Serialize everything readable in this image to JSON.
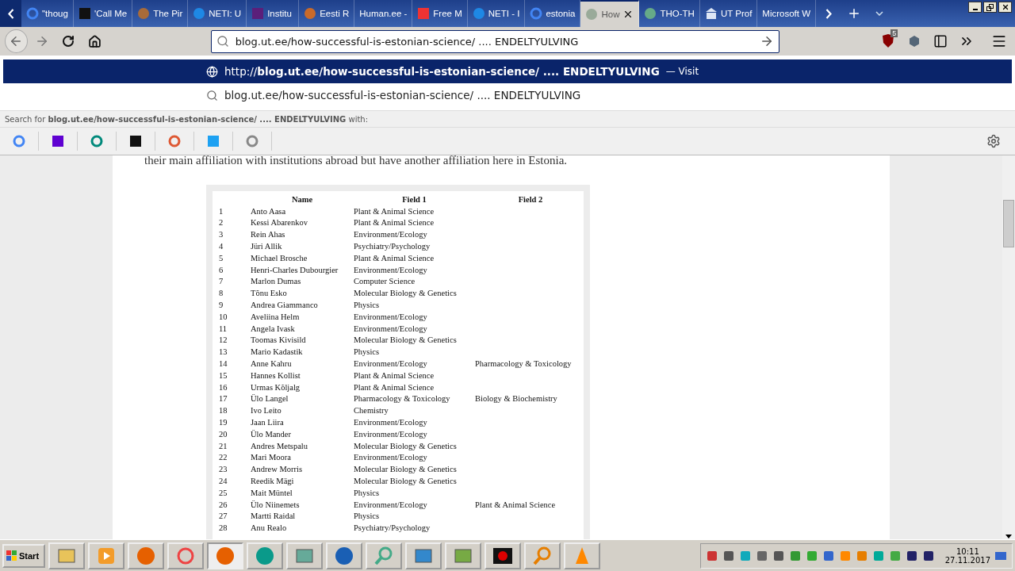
{
  "tabs": [
    {
      "label": "\"thoug",
      "selected": false
    },
    {
      "label": "'Call Me",
      "selected": false
    },
    {
      "label": "The Pir",
      "selected": false
    },
    {
      "label": "NETI: U",
      "selected": false
    },
    {
      "label": "Institu",
      "selected": false
    },
    {
      "label": "Eesti R",
      "selected": false
    },
    {
      "label": "Human.ee -",
      "selected": false
    },
    {
      "label": "Free M",
      "selected": false
    },
    {
      "label": "NETI - I",
      "selected": false
    },
    {
      "label": "estonia",
      "selected": false
    },
    {
      "label": "How",
      "selected": true
    },
    {
      "label": "THO-TH",
      "selected": false
    },
    {
      "label": "UT Prof",
      "selected": false
    },
    {
      "label": "Microsoft W",
      "selected": false
    }
  ],
  "address_bar": {
    "value": "blog.ut.ee/how-successful-is-estonian-science/ .... ENDELTYULVING"
  },
  "toolbar": {
    "ublock_badge": "5"
  },
  "dropdown": {
    "visit_row": {
      "url": "http://**blog.ut.ee/how-successful-is-estonian-science/ .... ENDELTYULVING**",
      "action": "— Visit",
      "selected": true
    },
    "search_row": {
      "text": "blog.ut.ee/how-successful-is-estonian-science/ .... ENDELTYULVING",
      "selected": false
    },
    "search_for": "Search for **blog.ut.ee/how-successful-is-estonian-science/ .... ENDELTYULVING** with:"
  },
  "page": {
    "paragraph": "their main affiliation with institutions abroad but have another affiliation here in Estonia.",
    "table": {
      "columns": [
        "Name",
        "Field  1",
        "Field 2"
      ],
      "rows": [
        {
          "num": "1",
          "name": "Anto Aasa",
          "field1": "Plant & Animal Science"
        },
        {
          "num": "2",
          "name": "Kessi Abarenkov",
          "field1": "Plant & Animal Science"
        },
        {
          "num": "3",
          "name": "Rein Ahas",
          "field1": "Environment/Ecology"
        },
        {
          "num": "4",
          "name": "Jüri Allik",
          "field1": "Psychiatry/Psychology"
        },
        {
          "num": "5",
          "name": "Michael Brosche",
          "field1": "Plant & Animal Science"
        },
        {
          "num": "6",
          "name": "Henri-Charles Dubourgier",
          "field1": "Environment/Ecology"
        },
        {
          "num": "7",
          "name": "Marlon Dumas",
          "field1": "Computer Science"
        },
        {
          "num": "8",
          "name": "Tõnu Esko",
          "field1": "Molecular Biology & Genetics"
        },
        {
          "num": "9",
          "name": "Andrea Giammanco",
          "field1": "Physics"
        },
        {
          "num": "10",
          "name": "Aveliina Helm",
          "field1": "Environment/Ecology"
        },
        {
          "num": "11",
          "name": "Angela Ivask",
          "field1": "Environment/Ecology"
        },
        {
          "num": "12",
          "name": "Toomas Kivisild",
          "field1": "Molecular Biology & Genetics"
        },
        {
          "num": "13",
          "name": "Mario Kadastik",
          "field1": "Physics"
        },
        {
          "num": "14",
          "name": "Anne Kahru",
          "field1": "Environment/Ecology",
          "field2": "Pharmacology & Toxicology"
        },
        {
          "num": "15",
          "name": "Hannes Kollist",
          "field1": "Plant & Animal Science"
        },
        {
          "num": "16",
          "name": "Urmas Kõljalg",
          "field1": "Plant & Animal Science"
        },
        {
          "num": "17",
          "name": "Ülo Langel",
          "field1": "Pharmacology & Toxicology",
          "field2": "Biology & Biochemistry"
        },
        {
          "num": "18",
          "name": "Ivo Leito",
          "field1": "Chemistry"
        },
        {
          "num": "19",
          "name": "Jaan Liira",
          "field1": "Environment/Ecology"
        },
        {
          "num": "20",
          "name": "Ülo Mander",
          "field1": "Environment/Ecology"
        },
        {
          "num": "21",
          "name": "Andres Metspalu",
          "field1": "Molecular Biology & Genetics"
        },
        {
          "num": "22",
          "name": "Mari Moora",
          "field1": "Environment/Ecology"
        },
        {
          "num": "23",
          "name": "Andrew Morris",
          "field1": "Molecular Biology & Genetics"
        },
        {
          "num": "24",
          "name": "Reedik Mägi",
          "field1": "Molecular Biology & Genetics"
        },
        {
          "num": "25",
          "name": "Mait Müntel",
          "field1": "Physics"
        },
        {
          "num": "26",
          "name": "Ülo Niinemets",
          "field1": "Environment/Ecology",
          "field2": "Plant & Animal Science"
        },
        {
          "num": "27",
          "name": "Martti Raidal",
          "field1": "Physics"
        },
        {
          "num": "28",
          "name": "Anu Realo",
          "field1": "Psychiatry/Psychology"
        }
      ]
    }
  },
  "taskbar": {
    "start": "Start",
    "clock_time": "10:11",
    "clock_date": "27.11.2017"
  }
}
